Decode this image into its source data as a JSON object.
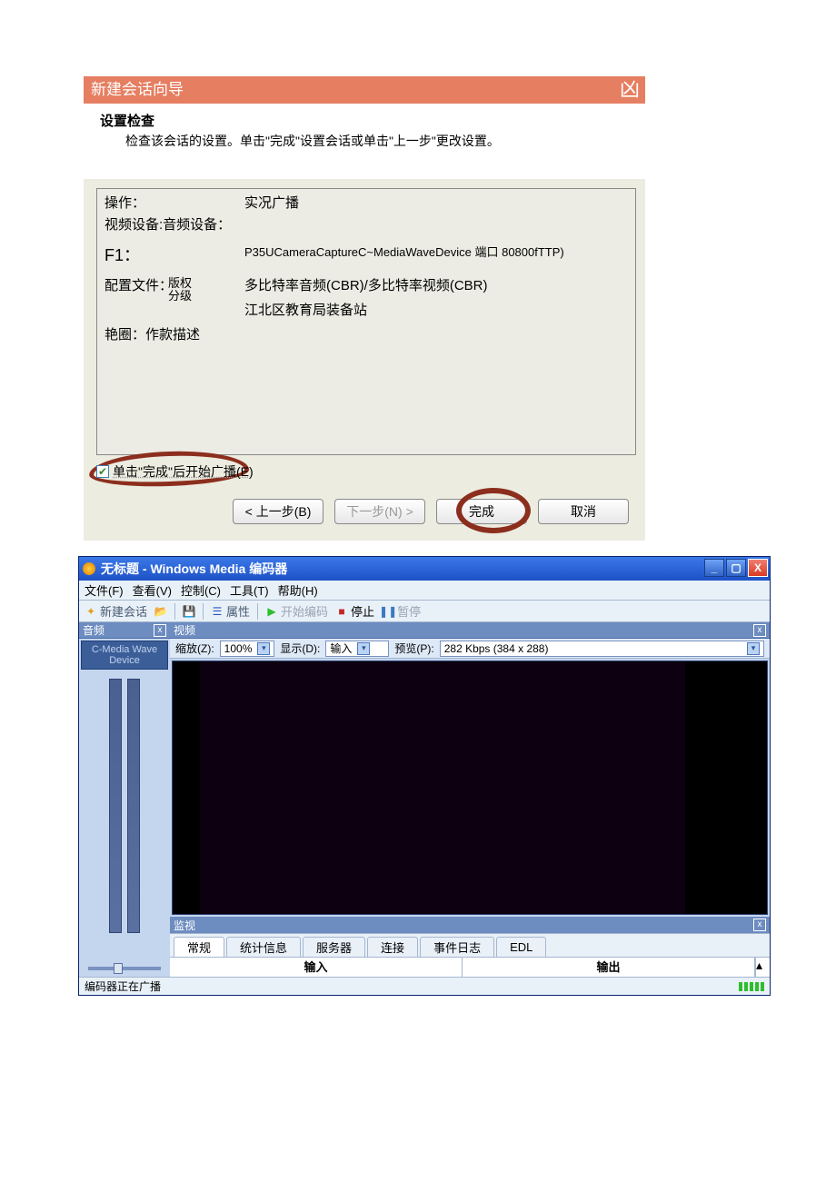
{
  "wizard": {
    "title": "新建会话向导",
    "close_glyph": "凶",
    "heading": "设置检查",
    "subheading": "检查该会话的设置。单击\"完成\"设置会话或单击\"上一步\"更改设置。",
    "rows": {
      "op_lbl": "操作：",
      "op_val": "实况广播",
      "dev_lbl": "视频设备:音频设备：",
      "f1_lbl": "F1：",
      "f1_val": "P35UCameraCaptureC~MediaWaveDevice 端口 80800fTTP)",
      "profile_lbl": "配置文件：",
      "profile_val": "多比特率音频(CBR)/多比特率视频(CBR)",
      "org_val": "江北区教育局装备站",
      "iris_lbl": "艳圈：作款描述",
      "side_terms": "版权\n分级"
    },
    "checkbox_label": "单击\"完成\"后开始广播(E)",
    "btn_back": "< 上一步(B)",
    "btn_next": "下一步(N) >",
    "btn_finish": "完成",
    "btn_cancel": "取消"
  },
  "encoder": {
    "title": "无标题 - Windows Media 编码器",
    "menus": {
      "file": "文件(F)",
      "view": "查看(V)",
      "control": "控制(C)",
      "tools": "工具(T)",
      "help": "帮助(H)"
    },
    "toolbar": {
      "newsession": "新建会话",
      "properties": "属性",
      "start": "开始编码",
      "stop": "停止",
      "pause": "暂停"
    },
    "audio": {
      "pane_title": "音频",
      "device": "C-Media Wave Device"
    },
    "video": {
      "pane_title": "视频",
      "zoom_lbl": "缩放(Z):",
      "zoom_val": "100%",
      "display_lbl": "显示(D):",
      "display_val": "输入",
      "preview_lbl": "预览(P):",
      "preview_val": "282 Kbps (384 x 288)"
    },
    "monitor_title": "监视",
    "tabs": {
      "general": "常规",
      "stats": "统计信息",
      "server": "服务器",
      "conn": "连接",
      "eventlog": "事件日志",
      "edl": "EDL"
    },
    "io": {
      "input": "输入",
      "output": "输出"
    },
    "status": "编码器正在广播"
  }
}
